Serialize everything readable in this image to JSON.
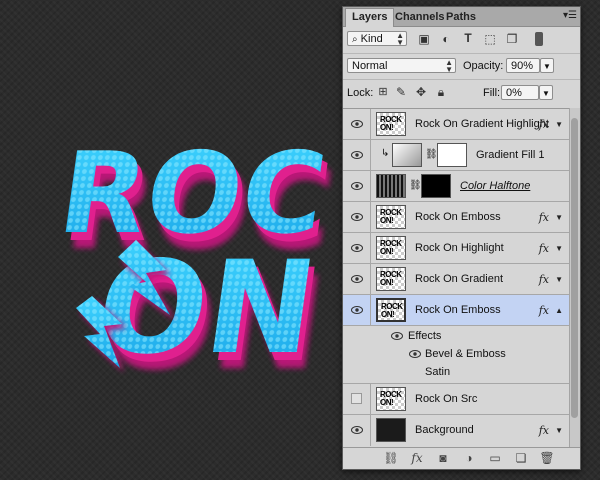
{
  "artwork": {
    "text_line1": "ROC",
    "text_line2": "ON"
  },
  "panel": {
    "tabs": [
      {
        "label": "Layers",
        "active": true
      },
      {
        "label": "Channels",
        "active": false
      },
      {
        "label": "Paths",
        "active": false
      }
    ],
    "menu_icon": "panel-menu-icon"
  },
  "filter": {
    "kind_label": "Kind",
    "icons": [
      "pixel-filter-icon",
      "adjustment-filter-icon",
      "type-filter-icon",
      "shape-filter-icon",
      "smart-object-filter-icon",
      "filter-toggle-icon"
    ]
  },
  "blend": {
    "mode": "Normal",
    "opacity_label": "Opacity:",
    "opacity_value": "90%"
  },
  "lock": {
    "label": "Lock:",
    "fill_label": "Fill:",
    "fill_value": "0%"
  },
  "layers": [
    {
      "name": "Rock On Gradient Highlight",
      "visible": true,
      "fx": "fx",
      "thumb_text": "ROCK ON!"
    },
    {
      "name": "Gradient Fill 1",
      "visible": true,
      "fx": "",
      "thumb_text": ""
    },
    {
      "name": "Color Halftone",
      "visible": true,
      "fx": "",
      "thumb_text": ""
    },
    {
      "name": "Rock On Emboss",
      "visible": true,
      "fx": "fx",
      "thumb_text": "ROCK ON!"
    },
    {
      "name": "Rock On Highlight",
      "visible": true,
      "fx": "fx",
      "thumb_text": "ROCK ON!"
    },
    {
      "name": "Rock On Gradient",
      "visible": true,
      "fx": "fx",
      "thumb_text": "ROCK ON!"
    },
    {
      "name": "Rock On Emboss",
      "visible": true,
      "fx": "fx",
      "thumb_text": "ROCK ON!",
      "selected": true
    }
  ],
  "effects": {
    "label": "Effects",
    "items": [
      "Bevel & Emboss",
      "Satin"
    ]
  },
  "layers_bottom": [
    {
      "name": "Rock On Src",
      "visible": false,
      "fx": "",
      "thumb_text": "ROCK ON!"
    },
    {
      "name": "Background",
      "visible": true,
      "fx": "fx"
    }
  ],
  "footer_icons": [
    "link-layers-icon",
    "add-style-icon",
    "add-mask-icon",
    "adjustment-layer-icon",
    "new-group-icon",
    "new-layer-icon",
    "trash-icon"
  ],
  "footer_fx": "fx"
}
